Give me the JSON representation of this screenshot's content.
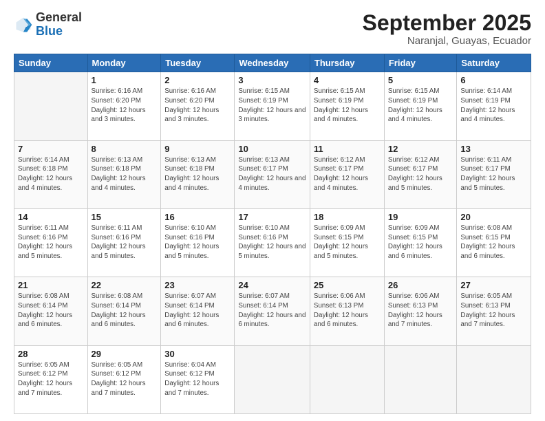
{
  "logo": {
    "general": "General",
    "blue": "Blue"
  },
  "title": "September 2025",
  "subtitle": "Naranjal, Guayas, Ecuador",
  "days_of_week": [
    "Sunday",
    "Monday",
    "Tuesday",
    "Wednesday",
    "Thursday",
    "Friday",
    "Saturday"
  ],
  "weeks": [
    [
      {
        "day": null
      },
      {
        "day": 1,
        "sunrise": "6:16 AM",
        "sunset": "6:20 PM",
        "daylight": "12 hours and 3 minutes."
      },
      {
        "day": 2,
        "sunrise": "6:16 AM",
        "sunset": "6:20 PM",
        "daylight": "12 hours and 3 minutes."
      },
      {
        "day": 3,
        "sunrise": "6:15 AM",
        "sunset": "6:19 PM",
        "daylight": "12 hours and 3 minutes."
      },
      {
        "day": 4,
        "sunrise": "6:15 AM",
        "sunset": "6:19 PM",
        "daylight": "12 hours and 4 minutes."
      },
      {
        "day": 5,
        "sunrise": "6:15 AM",
        "sunset": "6:19 PM",
        "daylight": "12 hours and 4 minutes."
      },
      {
        "day": 6,
        "sunrise": "6:14 AM",
        "sunset": "6:19 PM",
        "daylight": "12 hours and 4 minutes."
      }
    ],
    [
      {
        "day": 7,
        "sunrise": "6:14 AM",
        "sunset": "6:18 PM",
        "daylight": "12 hours and 4 minutes."
      },
      {
        "day": 8,
        "sunrise": "6:13 AM",
        "sunset": "6:18 PM",
        "daylight": "12 hours and 4 minutes."
      },
      {
        "day": 9,
        "sunrise": "6:13 AM",
        "sunset": "6:18 PM",
        "daylight": "12 hours and 4 minutes."
      },
      {
        "day": 10,
        "sunrise": "6:13 AM",
        "sunset": "6:17 PM",
        "daylight": "12 hours and 4 minutes."
      },
      {
        "day": 11,
        "sunrise": "6:12 AM",
        "sunset": "6:17 PM",
        "daylight": "12 hours and 4 minutes."
      },
      {
        "day": 12,
        "sunrise": "6:12 AM",
        "sunset": "6:17 PM",
        "daylight": "12 hours and 5 minutes."
      },
      {
        "day": 13,
        "sunrise": "6:11 AM",
        "sunset": "6:17 PM",
        "daylight": "12 hours and 5 minutes."
      }
    ],
    [
      {
        "day": 14,
        "sunrise": "6:11 AM",
        "sunset": "6:16 PM",
        "daylight": "12 hours and 5 minutes."
      },
      {
        "day": 15,
        "sunrise": "6:11 AM",
        "sunset": "6:16 PM",
        "daylight": "12 hours and 5 minutes."
      },
      {
        "day": 16,
        "sunrise": "6:10 AM",
        "sunset": "6:16 PM",
        "daylight": "12 hours and 5 minutes."
      },
      {
        "day": 17,
        "sunrise": "6:10 AM",
        "sunset": "6:16 PM",
        "daylight": "12 hours and 5 minutes."
      },
      {
        "day": 18,
        "sunrise": "6:09 AM",
        "sunset": "6:15 PM",
        "daylight": "12 hours and 5 minutes."
      },
      {
        "day": 19,
        "sunrise": "6:09 AM",
        "sunset": "6:15 PM",
        "daylight": "12 hours and 6 minutes."
      },
      {
        "day": 20,
        "sunrise": "6:08 AM",
        "sunset": "6:15 PM",
        "daylight": "12 hours and 6 minutes."
      }
    ],
    [
      {
        "day": 21,
        "sunrise": "6:08 AM",
        "sunset": "6:14 PM",
        "daylight": "12 hours and 6 minutes."
      },
      {
        "day": 22,
        "sunrise": "6:08 AM",
        "sunset": "6:14 PM",
        "daylight": "12 hours and 6 minutes."
      },
      {
        "day": 23,
        "sunrise": "6:07 AM",
        "sunset": "6:14 PM",
        "daylight": "12 hours and 6 minutes."
      },
      {
        "day": 24,
        "sunrise": "6:07 AM",
        "sunset": "6:14 PM",
        "daylight": "12 hours and 6 minutes."
      },
      {
        "day": 25,
        "sunrise": "6:06 AM",
        "sunset": "6:13 PM",
        "daylight": "12 hours and 6 minutes."
      },
      {
        "day": 26,
        "sunrise": "6:06 AM",
        "sunset": "6:13 PM",
        "daylight": "12 hours and 7 minutes."
      },
      {
        "day": 27,
        "sunrise": "6:05 AM",
        "sunset": "6:13 PM",
        "daylight": "12 hours and 7 minutes."
      }
    ],
    [
      {
        "day": 28,
        "sunrise": "6:05 AM",
        "sunset": "6:12 PM",
        "daylight": "12 hours and 7 minutes."
      },
      {
        "day": 29,
        "sunrise": "6:05 AM",
        "sunset": "6:12 PM",
        "daylight": "12 hours and 7 minutes."
      },
      {
        "day": 30,
        "sunrise": "6:04 AM",
        "sunset": "6:12 PM",
        "daylight": "12 hours and 7 minutes."
      },
      {
        "day": null
      },
      {
        "day": null
      },
      {
        "day": null
      },
      {
        "day": null
      }
    ]
  ]
}
